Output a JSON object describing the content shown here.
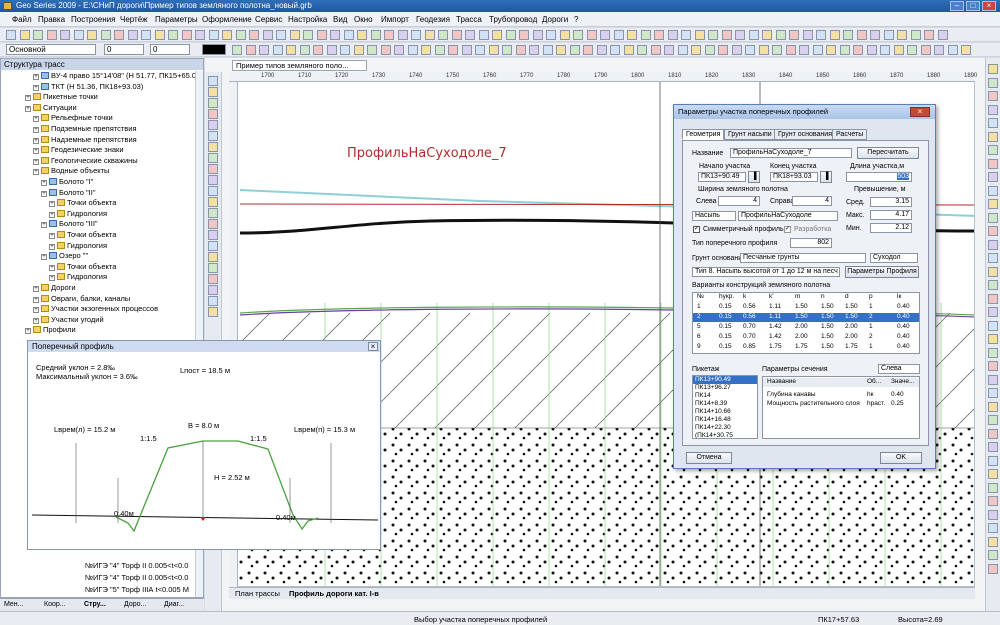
{
  "window": {
    "title": "Geo Series 2009 - E:\\СНиП дороги\\Пример типов земляного полотна_новый.grb"
  },
  "menu": [
    "Файл",
    "Правка",
    "Построения",
    "Чертёж",
    "Параметры",
    "Оформление",
    "Сервис",
    "Настройка",
    "Вид",
    "Окно",
    "Импорт",
    "Геодезия",
    "Трасса",
    "Трубопровод",
    "Дороги",
    "?"
  ],
  "toolbar": {
    "layer_value": "Основной",
    "num1": "0",
    "num2": "0"
  },
  "left_panel": {
    "title": "Структура трасс",
    "items": [
      {
        "label": "ВУ-4 право 15°14'08\" (Н 51.77, ПК15+65.0",
        "indent": 3,
        "type": "leaf"
      },
      {
        "label": "ТКТ (Н 51.36, ПК18+93.03)",
        "indent": 3,
        "type": "leaf"
      },
      {
        "label": "Пикетные точки",
        "indent": 2,
        "type": "fold"
      },
      {
        "label": "Ситуации",
        "indent": 2,
        "type": "fold"
      },
      {
        "label": "Рельефные точки",
        "indent": 3,
        "type": "fold"
      },
      {
        "label": "Подземные препятствия",
        "indent": 3,
        "type": "fold"
      },
      {
        "label": "Надземные препятствия",
        "indent": 3,
        "type": "fold"
      },
      {
        "label": "Геодезические знаки",
        "indent": 3,
        "type": "fold"
      },
      {
        "label": "Геологические скважины",
        "indent": 3,
        "type": "fold"
      },
      {
        "label": "Водные объекты",
        "indent": 3,
        "type": "fold"
      },
      {
        "label": "Болото \"I\"",
        "indent": 4,
        "type": "leaf"
      },
      {
        "label": "Болото \"II\"",
        "indent": 4,
        "type": "leaf"
      },
      {
        "label": "Точки объекта",
        "indent": 5,
        "type": "fold"
      },
      {
        "label": "Гидрология",
        "indent": 5,
        "type": "fold"
      },
      {
        "label": "Болото \"III\"",
        "indent": 4,
        "type": "leaf"
      },
      {
        "label": "Точки объекта",
        "indent": 5,
        "type": "fold"
      },
      {
        "label": "Гидрология",
        "indent": 5,
        "type": "fold"
      },
      {
        "label": "Озеро \"\"",
        "indent": 4,
        "type": "leaf"
      },
      {
        "label": "Точки объекта",
        "indent": 5,
        "type": "fold"
      },
      {
        "label": "Гидрология",
        "indent": 5,
        "type": "fold"
      },
      {
        "label": "Дороги",
        "indent": 3,
        "type": "fold"
      },
      {
        "label": "Овраги, балки, каналы",
        "indent": 3,
        "type": "fold"
      },
      {
        "label": "Участки экзогенных процессов",
        "indent": 3,
        "type": "fold"
      },
      {
        "label": "Участки угодий",
        "indent": 3,
        "type": "fold"
      },
      {
        "label": "Профили",
        "indent": 2,
        "type": "fold"
      }
    ],
    "bottom_items": [
      "№ИГЭ \"4\" Торф II 0.005<t<0.0",
      "№ИГЭ \"4\" Торф II 0.005<t<0.0",
      "№ИГЭ \"5\" Торф IIIА t<0.005 М"
    ]
  },
  "bottom_tabs": [
    "Мен...",
    "Коор...",
    "Стру...",
    "Доро...",
    "Диаг..."
  ],
  "document": {
    "tab": "Пример типов земляного поло...",
    "profile_name": "ПрофильНаСуходоле_7",
    "ruler_labels": [
      "1700",
      "1710",
      "1720",
      "1730",
      "1740",
      "1750",
      "1760",
      "1770",
      "1780",
      "1790",
      "1800",
      "1810",
      "1820",
      "1830",
      "1840",
      "1850",
      "1860",
      "1870",
      "1880",
      "1890"
    ],
    "sheet_tabs": [
      "План трассы",
      "Профиль дороги кат. I-в"
    ]
  },
  "cross_profile": {
    "title": "Поперечный профиль",
    "avg_slope": "Средний уклон = 2.8‰",
    "max_slope": "Максимальный уклон = 3.6‰",
    "l_slope": "Lпост = 18.5 м",
    "b": "B = 8.0 м",
    "h": "H = 2.52 м",
    "slope_left": "1:1.5",
    "slope_right": "1:1.5",
    "l_left": "Lврем(л) = 15.2 м",
    "l_right": "Lврем(п) = 15.3 м",
    "ditch_left": "0.40м",
    "ditch_right": "0.40м"
  },
  "dialog": {
    "title": "Параметры участка поперечных профилей",
    "tabs": [
      "Геометрия",
      "Грунт насыпи",
      "Грунт основания",
      "Расчеты"
    ],
    "name_label": "Название",
    "name_value": "ПрофильНаСуходоле_7",
    "recalc_button": "Пересчитать",
    "start_label": "Начало участка",
    "start_value": "ПК13+90.49",
    "end_label": "Конец участка",
    "end_value": "ПК18+93.03",
    "length_label": "Длина участка,м",
    "length_value": "503",
    "width_label": "Ширина земляного полотна",
    "left_label": "Слева",
    "left_value": "4",
    "right_label": "Справа",
    "right_value": "4",
    "excess_label": "Превышение, м",
    "avg_label": "Сред.",
    "avg_value": "3.15",
    "max_label": "Макс.",
    "max_value": "4.17",
    "min_label": "Мин.",
    "min_value": "2.12",
    "fill_type": "Насыпь",
    "profile_type": "ПрофильНаСуходоле",
    "sym_label": "Симметричный профиль",
    "dev_label": "Разработка",
    "type_label": "Тип поперечного профиля",
    "type_value": "802",
    "soil_label": "Грунт основания",
    "soil_value": "Песчаные грунты",
    "dry_value": "Суходол",
    "type8_value": "Тип 8. Насыпь высотой от 1 до 12 м на песч",
    "profile_params_button": "Параметры Профиля",
    "variants_label": "Варианты конструкций земляного полотна",
    "table": {
      "headers": [
        "№",
        "hукр.",
        "k",
        "k'",
        "m",
        "n",
        "d",
        "p",
        "lк"
      ],
      "rows": [
        [
          "1",
          "0.15",
          "0.56",
          "1.11",
          "1.50",
          "1.50",
          "1.50",
          "1",
          "0.40"
        ],
        [
          "2",
          "0.15",
          "0.56",
          "1.11",
          "1.50",
          "1.50",
          "1.50",
          "2",
          "0.40"
        ],
        [
          "5",
          "0.15",
          "0.70",
          "1.42",
          "2.00",
          "1.50",
          "2.00",
          "1",
          "0.40"
        ],
        [
          "6",
          "0.15",
          "0.70",
          "1.42",
          "2.00",
          "1.50",
          "2.00",
          "2",
          "0.40"
        ],
        [
          "9",
          "0.15",
          "0.85",
          "1.75",
          "1.75",
          "1.50",
          "1.75",
          "1",
          "0.40"
        ]
      ],
      "selected": 1
    },
    "picket_label": "Пикетаж",
    "pickets": [
      "ПК13+90.49",
      "ПК13+96.27",
      "ПК14",
      "ПК14+8.39",
      "ПК14+10.66",
      "ПК14+16.48",
      "ПК14+22.30",
      "(ПК14+30.75"
    ],
    "section_label": "Параметры сечения",
    "section_side": "Слева",
    "params_headers": [
      "Название",
      "Об...",
      "Значе..."
    ],
    "params_rows": [
      [
        "Глубина канавы",
        "hк",
        "0.40"
      ],
      [
        "Мощность растительного слоя",
        "hраст.",
        "0.25"
      ]
    ],
    "cancel_button": "Отмена",
    "ok_button": "OK"
  },
  "status": {
    "message": "Выбор участка поперечных профилей",
    "picket": "ПК17+57.63",
    "height": "Высота=2.69"
  }
}
